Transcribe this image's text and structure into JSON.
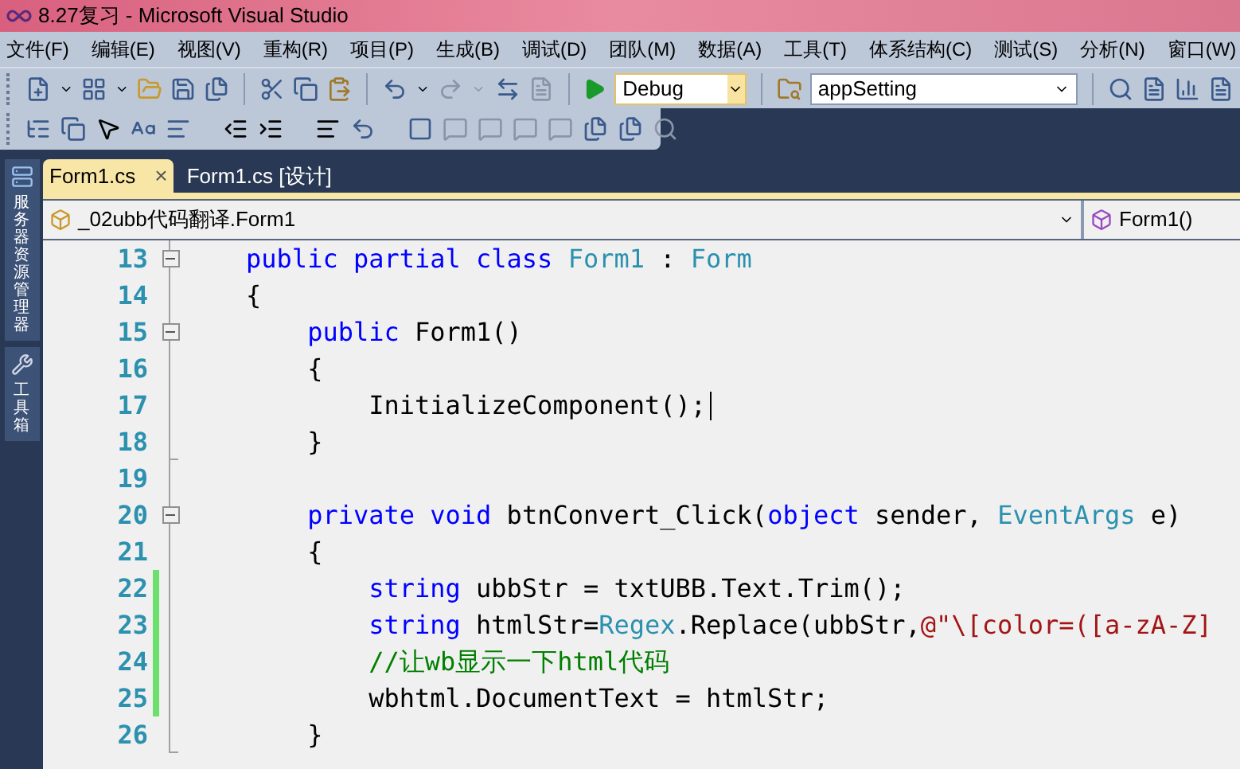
{
  "window": {
    "title": "8.27复习 - Microsoft Visual Studio"
  },
  "menu": [
    "文件(F)",
    "编辑(E)",
    "视图(V)",
    "重构(R)",
    "项目(P)",
    "生成(B)",
    "调试(D)",
    "团队(M)",
    "数据(A)",
    "工具(T)",
    "体系结构(C)",
    "测试(S)",
    "分析(N)",
    "窗口(W)"
  ],
  "toolbar": {
    "configuration": "Debug",
    "search_combo": "appSetting"
  },
  "side_tabs": [
    {
      "label": "服务器资源管理器"
    },
    {
      "label": "工具箱"
    }
  ],
  "tabs": [
    {
      "label": "Form1.cs",
      "selected": true,
      "close": "×"
    },
    {
      "label": "Form1.cs [设计]",
      "selected": false
    }
  ],
  "nav": {
    "type_combo": "_02ubb代码翻译.Form1",
    "member_combo": "Form1()"
  },
  "lines": [
    {
      "number": "13",
      "collapsible": true,
      "block_end": false,
      "changed": false,
      "tokens": [
        {
          "kind": "keyword",
          "text": "    public"
        },
        {
          "kind": "keyword",
          "text": " partial"
        },
        {
          "kind": "keyword",
          "text": " class"
        },
        {
          "kind": "type",
          "text": " Form1"
        },
        {
          "kind": "plain",
          "text": " : "
        },
        {
          "kind": "type",
          "text": "Form"
        }
      ]
    },
    {
      "number": "14",
      "collapsible": false,
      "block_end": false,
      "changed": false,
      "tokens": [
        {
          "kind": "plain",
          "text": "    {"
        }
      ]
    },
    {
      "number": "15",
      "collapsible": true,
      "block_end": false,
      "changed": false,
      "tokens": [
        {
          "kind": "keyword",
          "text": "        public"
        },
        {
          "kind": "plain",
          "text": " Form1()"
        }
      ]
    },
    {
      "number": "16",
      "collapsible": false,
      "block_end": false,
      "changed": false,
      "tokens": [
        {
          "kind": "plain",
          "text": "        {"
        }
      ]
    },
    {
      "number": "17",
      "collapsible": false,
      "block_end": false,
      "changed": false,
      "caret": true,
      "tokens": [
        {
          "kind": "plain",
          "text": "            InitializeComponent();"
        }
      ]
    },
    {
      "number": "18",
      "collapsible": false,
      "block_end": true,
      "changed": false,
      "tokens": [
        {
          "kind": "plain",
          "text": "        }"
        }
      ]
    },
    {
      "number": "19",
      "collapsible": false,
      "block_end": false,
      "changed": false
    },
    {
      "number": "20",
      "collapsible": true,
      "block_end": false,
      "changed": false,
      "tokens": [
        {
          "kind": "keyword",
          "text": "        private"
        },
        {
          "kind": "keyword",
          "text": " void"
        },
        {
          "kind": "plain",
          "text": " btnConvert_Click("
        },
        {
          "kind": "keyword",
          "text": "object"
        },
        {
          "kind": "plain",
          "text": " sender, "
        },
        {
          "kind": "type",
          "text": "EventArgs"
        },
        {
          "kind": "plain",
          "text": " e)"
        }
      ]
    },
    {
      "number": "21",
      "collapsible": false,
      "block_end": false,
      "changed": false,
      "tokens": [
        {
          "kind": "plain",
          "text": "        {"
        }
      ]
    },
    {
      "number": "22",
      "collapsible": false,
      "block_end": false,
      "changed": true,
      "tokens": [
        {
          "kind": "keyword",
          "text": "            string"
        },
        {
          "kind": "plain",
          "text": " ubbStr = txtUBB.Text.Trim();"
        }
      ]
    },
    {
      "number": "23",
      "collapsible": false,
      "block_end": false,
      "changed": true,
      "tokens": [
        {
          "kind": "keyword",
          "text": "            string"
        },
        {
          "kind": "plain",
          "text": " htmlStr="
        },
        {
          "kind": "type",
          "text": "Regex"
        },
        {
          "kind": "plain",
          "text": ".Replace(ubbStr,"
        },
        {
          "kind": "string",
          "text": "@\"\\[color=([a-zA-Z]"
        }
      ]
    },
    {
      "number": "24",
      "collapsible": false,
      "block_end": false,
      "changed": true,
      "tokens": [
        {
          "kind": "comment",
          "text": "            //让wb显示一下html代码"
        }
      ]
    },
    {
      "number": "25",
      "collapsible": false,
      "block_end": false,
      "changed": true,
      "tokens": [
        {
          "kind": "plain",
          "text": "            wbhtml.DocumentText = htmlStr;"
        }
      ]
    },
    {
      "number": "26",
      "collapsible": false,
      "block_end": true,
      "changed": false,
      "tokens": [
        {
          "kind": "plain",
          "text": "        }"
        }
      ]
    }
  ]
}
